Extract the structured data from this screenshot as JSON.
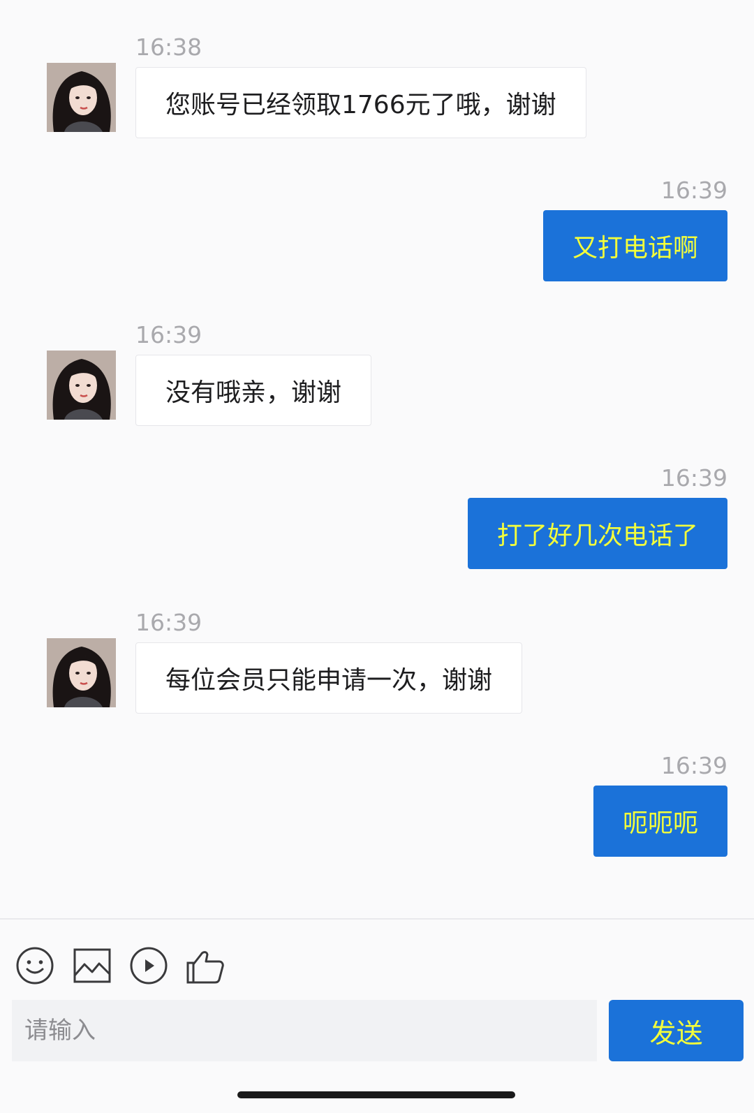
{
  "messages": [
    {
      "side": "left",
      "time": "16:38",
      "text": "您账号已经领取1766元了哦，谢谢"
    },
    {
      "side": "right",
      "time": "16:39",
      "text": "又打电话啊"
    },
    {
      "side": "left",
      "time": "16:39",
      "text": "没有哦亲，谢谢"
    },
    {
      "side": "right",
      "time": "16:39",
      "text": "打了好几次电话了"
    },
    {
      "side": "left",
      "time": "16:39",
      "text": "每位会员只能申请一次，谢谢"
    },
    {
      "side": "right",
      "time": "16:39",
      "text": "呃呃呃"
    }
  ],
  "toolbar": {
    "icons": [
      "emoji-icon",
      "image-icon",
      "video-play-icon",
      "thumbs-up-icon"
    ]
  },
  "composer": {
    "placeholder": "请输入",
    "value": "",
    "send_label": "发送"
  },
  "colors": {
    "background": "#fafafb",
    "outgoing_bubble": "#1b72d9",
    "outgoing_text": "#f4ff3a",
    "incoming_bubble": "#ffffff",
    "timestamp": "#a9a9ad"
  }
}
